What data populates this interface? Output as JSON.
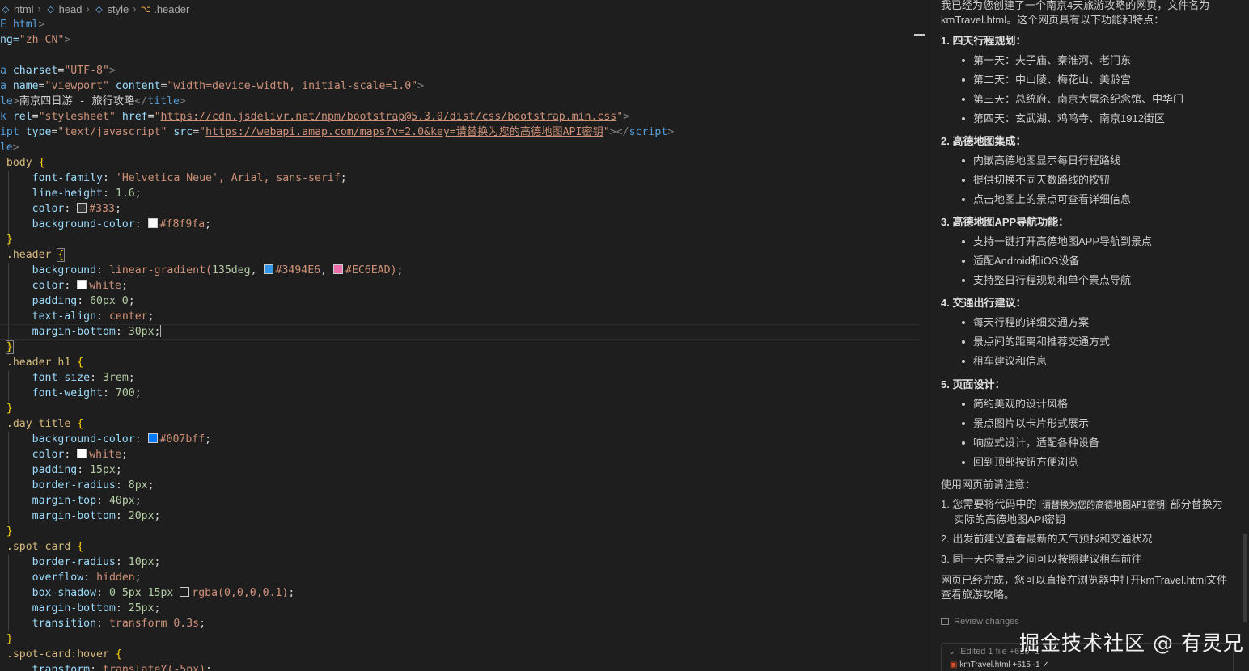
{
  "breadcrumb": [
    {
      "label": "html",
      "icon": "cube-icon"
    },
    {
      "label": "head",
      "icon": "cube-icon"
    },
    {
      "label": "style",
      "icon": "cube-icon"
    },
    {
      "label": ".header",
      "icon": "selector-icon"
    }
  ],
  "code": {
    "l1_a": "PE html",
    "l2_a": "ang=",
    "l2_b": "\"zh-CN\"",
    "l4_a": "ta ",
    "l4_b": "charset",
    "l4_c": "\"UTF-8\"",
    "l5_a": "ta ",
    "l5_b": "name",
    "l5_c": "\"viewport\"",
    "l5_d": "content",
    "l5_e": "\"width=device-width, initial-scale=1.0\"",
    "l6_a": "tle",
    "l6_b": "南京四日游 - 旅行攻略",
    "l6_c": "</",
    "l6_d": "title",
    "l7_a": "nk ",
    "l7_b": "rel",
    "l7_c": "\"stylesheet\"",
    "l7_d": "href",
    "l7_e": "https://cdn.jsdelivr.net/npm/bootstrap@5.3.0/dist/css/bootstrap.min.css",
    "l8_a": "ript ",
    "l8_b": "type",
    "l8_c": "\"text/javascript\"",
    "l8_d": "src",
    "l8_e": "https://webapi.amap.com/maps?v=2.0&key=请替换为您的高德地图API密钥",
    "l8_f": "script",
    "l9_a": "yle",
    "l10_sel": "body",
    "l11_p": "font-family",
    "l11_v": "'Helvetica Neue', Arial, sans-serif",
    "l12_p": "line-height",
    "l12_v": "1.6",
    "l13_p": "color",
    "l13_v": "#333",
    "l14_p": "background-color",
    "l14_v": "#f8f9fa",
    "l16_sel": ".header",
    "l17_p": "background",
    "l17_fn": "linear-gradient(",
    "l17_n": "135deg",
    "l17_c1": "#3494E6",
    "l17_c2": "#EC6EAD",
    "l18_p": "color",
    "l18_v": "white",
    "l19_p": "padding",
    "l19_v": "60px 0",
    "l20_p": "text-align",
    "l20_v": "center",
    "l21_p": "margin-bottom",
    "l21_v": "30px",
    "l23_sel": ".header h1",
    "l24_p": "font-size",
    "l24_v": "3rem",
    "l25_p": "font-weight",
    "l25_v": "700",
    "l27_sel": ".day-title",
    "l28_p": "background-color",
    "l28_v": "#007bff",
    "l29_p": "color",
    "l29_v": "white",
    "l30_p": "padding",
    "l30_v": "15px",
    "l31_p": "border-radius",
    "l31_v": "8px",
    "l32_p": "margin-top",
    "l32_v": "40px",
    "l33_p": "margin-bottom",
    "l33_v": "20px",
    "l35_sel": ".spot-card",
    "l36_p": "border-radius",
    "l36_v": "10px",
    "l37_p": "overflow",
    "l37_v": "hidden",
    "l38_p": "box-shadow",
    "l38_v": "0 5px 15px",
    "l38_c": "rgba(0,0,0,0.1)",
    "l39_p": "margin-bottom",
    "l39_v": "25px",
    "l40_p": "transition",
    "l40_v": "transform 0.3s",
    "l42_sel": ".spot-card:hover",
    "l43_p": "transform",
    "l43_v": "translateY(-5px)"
  },
  "swatches": {
    "c333": "#333333",
    "cf8f9fa": "#f8f9fa",
    "c3494E6": "#3494E6",
    "cEC6EAD": "#EC6EAD",
    "cwhite": "#ffffff",
    "c007bff": "#007bff",
    "crgba": "#1e1e1e"
  },
  "chat": {
    "intro": "我已经为您创建了一个南京4天旅游攻略的网页，文件名为kmTravel.html。这个网页具有以下功能和特点：",
    "sections": [
      {
        "title": "1. 四天行程规划：",
        "items": [
          "第一天：夫子庙、秦淮河、老门东",
          "第二天：中山陵、梅花山、美龄宫",
          "第三天：总统府、南京大屠杀纪念馆、中华门",
          "第四天：玄武湖、鸡鸣寺、南京1912街区"
        ]
      },
      {
        "title": "2. 高德地图集成：",
        "items": [
          "内嵌高德地图显示每日行程路线",
          "提供切换不同天数路线的按钮",
          "点击地图上的景点可查看详细信息"
        ]
      },
      {
        "title": "3. 高德地图APP导航功能：",
        "items": [
          "支持一键打开高德地图APP导航到景点",
          "适配Android和iOS设备",
          "支持整日行程规划和单个景点导航"
        ]
      },
      {
        "title": "4. 交通出行建议：",
        "items": [
          "每天行程的详细交通方案",
          "景点间的距离和推荐交通方式",
          "租车建议和信息"
        ]
      },
      {
        "title": "5. 页面设计：",
        "items": [
          "简约美观的设计风格",
          "景点图片以卡片形式展示",
          "响应式设计，适配各种设备",
          "回到顶部按钮方便浏览"
        ]
      }
    ],
    "notes_title": "使用网页前请注意：",
    "note1_a": "1. 您需要将代码中的",
    "note1_code": "请替换为您的高德地图API密钥",
    "note1_b": "部分替换为",
    "note1_c": "实际的高德地图API密钥",
    "note2": "2. 出发前建议查看最新的天气预报和交通状况",
    "note3": "3. 同一天内景点之间可以按照建议租车前往",
    "outro": "网页已经完成，您可以直接在浏览器中打开kmTravel.html文件查看旅游攻略。",
    "review": "Review changes",
    "edited": "Edited 1 file +615 -1",
    "file": "kmTravel.html +615 -1 ✓"
  },
  "watermark": "掘金技术社区 @ 有灵兄"
}
